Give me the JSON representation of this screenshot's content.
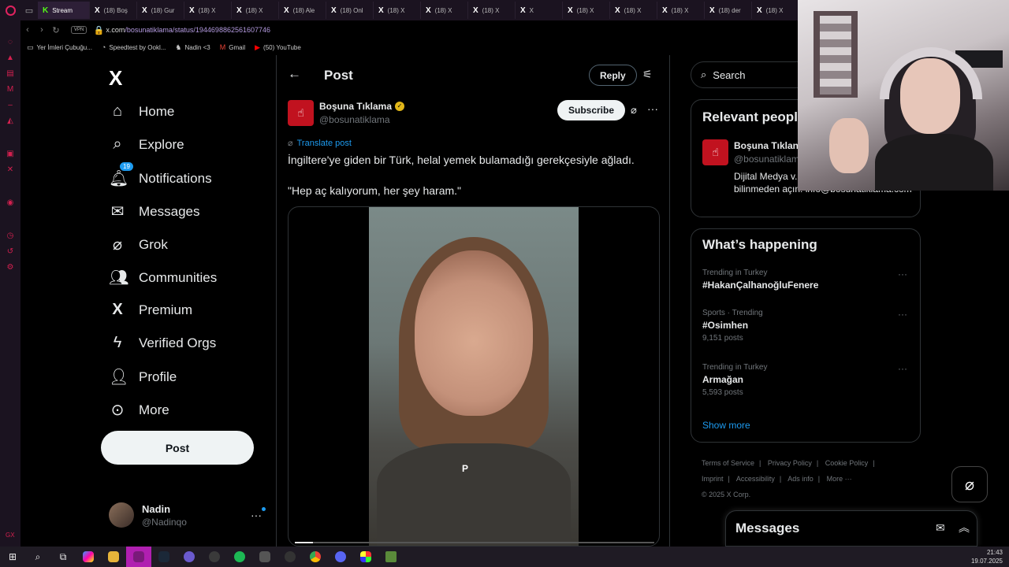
{
  "browser": {
    "tabs": [
      {
        "label": "Stream",
        "active": true,
        "icon": "kick-icon"
      },
      {
        "label": "(18) Boş",
        "icon": "x-icon"
      },
      {
        "label": "(18) Gur",
        "icon": "x-icon"
      },
      {
        "label": "(18) X",
        "icon": "x-icon"
      },
      {
        "label": "(18) X",
        "icon": "x-icon"
      },
      {
        "label": "(18) Ale",
        "icon": "x-icon"
      },
      {
        "label": "(18) Onl",
        "icon": "x-icon"
      },
      {
        "label": "(18) X",
        "icon": "x-icon"
      },
      {
        "label": "(18) X",
        "icon": "x-icon"
      },
      {
        "label": "(18) X",
        "icon": "x-icon"
      },
      {
        "label": "X",
        "icon": "x-icon"
      },
      {
        "label": "(18) X",
        "icon": "x-icon"
      },
      {
        "label": "(18) X",
        "icon": "x-icon"
      },
      {
        "label": "(18) X",
        "icon": "x-icon"
      },
      {
        "label": "(18) der",
        "icon": "x-icon"
      },
      {
        "label": "(18) X",
        "icon": "x-icon"
      }
    ],
    "vpn_label": "VPN",
    "url_host": "x.com",
    "url_path": "/bosunatiklama/status/1944698862561607746",
    "bookmarks": [
      {
        "label": "Yer İmleri Çubuğu...",
        "icon": "folder-icon"
      },
      {
        "label": "Speedtest by Ookl...",
        "icon": "speedtest-icon"
      },
      {
        "label": "Nadin <3",
        "icon": "bookmark-icon"
      },
      {
        "label": "Gmail",
        "icon": "gmail-icon"
      },
      {
        "label": "(50) YouTube",
        "icon": "youtube-icon"
      }
    ]
  },
  "nav": {
    "logo": "X",
    "items": [
      {
        "label": "Home",
        "icon": "home-icon"
      },
      {
        "label": "Explore",
        "icon": "search-icon"
      },
      {
        "label": "Notifications",
        "icon": "bell-icon",
        "badge": "19"
      },
      {
        "label": "Messages",
        "icon": "mail-icon"
      },
      {
        "label": "Grok",
        "icon": "grok-icon"
      },
      {
        "label": "Communities",
        "icon": "communities-icon"
      },
      {
        "label": "Premium",
        "icon": "x-premium-icon"
      },
      {
        "label": "Verified Orgs",
        "icon": "lightning-icon"
      },
      {
        "label": "Profile",
        "icon": "person-icon"
      },
      {
        "label": "More",
        "icon": "more-circle-icon"
      }
    ],
    "post_label": "Post",
    "account": {
      "name": "Nadin",
      "handle": "@Nadinqo"
    }
  },
  "post": {
    "header_title": "Post",
    "reply_label": "Reply",
    "author_name": "Boşuna Tıklama",
    "author_handle": "@bosunatiklama",
    "subscribe_label": "Subscribe",
    "translate_label": "Translate post",
    "text_line1": "İngiltere'ye giden bir Türk, helal yemek bulamadığı gerekçesiyle ağladı.",
    "text_line2": "\"Hep aç kalıyorum, her şey haram.\"",
    "video_watermark": "P",
    "video_progress": 0.05
  },
  "right": {
    "search_placeholder": "Search",
    "relevant_title": "Relevant people",
    "relevant_name": "Boşuna Tıklan",
    "relevant_handle": "@bosunatiklam",
    "relevant_bio": "Dijital Medya v... tıkla takip etmek için bilinmeden açın. info@bosunatiklama.com",
    "happening_title": "What’s happening",
    "trends": [
      {
        "context": "Trending in Turkey",
        "name": "#HakanÇalhanoğluFenere",
        "count": ""
      },
      {
        "context": "Sports · Trending",
        "name": "#Osimhen",
        "count": "9,151 posts"
      },
      {
        "context": "Trending in Turkey",
        "name": "Armağan",
        "count": "5,593 posts"
      }
    ],
    "show_more": "Show more",
    "footer_links": [
      "Terms of Service",
      "|",
      "Privacy Policy",
      "|",
      "Cookie Policy",
      "|",
      "Imprint",
      "|",
      "Accessibility",
      "|",
      "Ads info",
      "|",
      "More ···"
    ],
    "copyright": "© 2025 X Corp."
  },
  "messages_dock": {
    "title": "Messages"
  },
  "taskbar": {
    "time": "21:43",
    "date": "19.07.2025"
  },
  "colors": {
    "accent": "#1d9bf0",
    "brand_red": "#c1121f",
    "opera_red": "#e0235f"
  }
}
